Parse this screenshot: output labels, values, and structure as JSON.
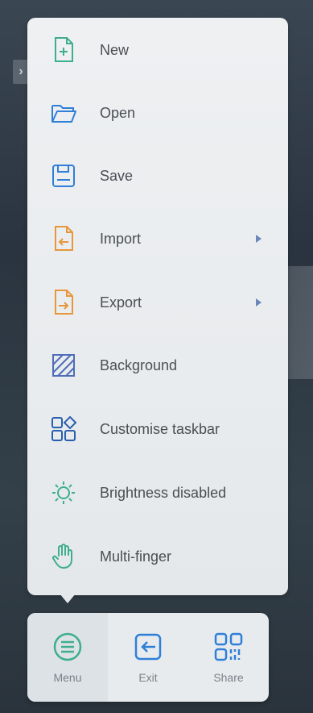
{
  "side_toggle": {
    "glyph": "›"
  },
  "menu": {
    "items": [
      {
        "label": "New",
        "icon": "new-file-icon",
        "color": "#3fae8c",
        "submenu": false
      },
      {
        "label": "Open",
        "icon": "folder-open-icon",
        "color": "#2f7fd8",
        "submenu": false
      },
      {
        "label": "Save",
        "icon": "save-icon",
        "color": "#2f7fd8",
        "submenu": false
      },
      {
        "label": "Import",
        "icon": "import-icon",
        "color": "#e7963b",
        "submenu": true
      },
      {
        "label": "Export",
        "icon": "export-icon",
        "color": "#e7963b",
        "submenu": true
      },
      {
        "label": "Background",
        "icon": "background-icon",
        "color": "#4f6db8",
        "submenu": false
      },
      {
        "label": "Customise taskbar",
        "icon": "customise-taskbar-icon",
        "color": "#2a5fb0",
        "submenu": false
      },
      {
        "label": "Brightness disabled",
        "icon": "brightness-icon",
        "color": "#3fae8c",
        "submenu": false
      },
      {
        "label": "Multi-finger",
        "icon": "hand-icon",
        "color": "#3fae8c",
        "submenu": false
      }
    ]
  },
  "bottom_bar": {
    "buttons": [
      {
        "label": "Menu",
        "icon": "menu-icon",
        "color": "#3fae8c",
        "active": true
      },
      {
        "label": "Exit",
        "icon": "exit-icon",
        "color": "#2f7fd8",
        "active": false
      },
      {
        "label": "Share",
        "icon": "qr-code-icon",
        "color": "#2f7fd8",
        "active": false
      }
    ]
  },
  "colors": {
    "accent_green": "#3fae8c",
    "accent_blue": "#2f7fd8",
    "accent_orange": "#e7963b",
    "panel": "#eef0f2",
    "text": "#4a4f55"
  }
}
